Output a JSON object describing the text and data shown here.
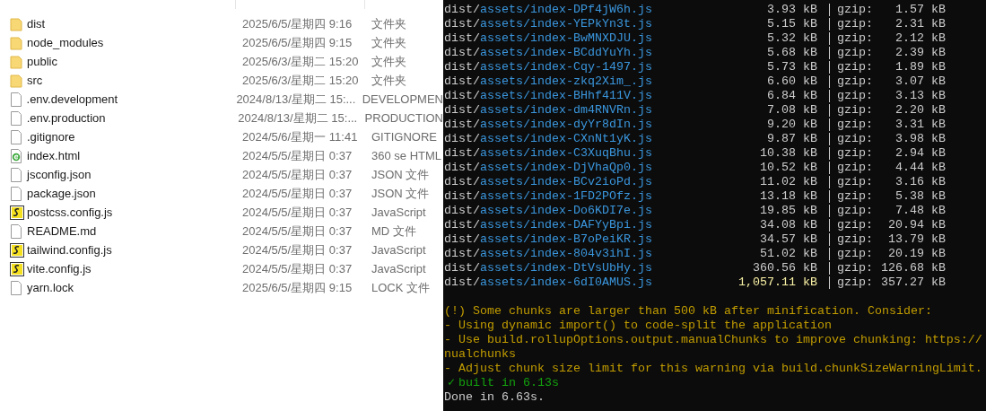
{
  "files": [
    {
      "name": "dist",
      "modified": "2025/6/5/星期四 9:16",
      "type": "文件夹",
      "kind": "folder"
    },
    {
      "name": "node_modules",
      "modified": "2025/6/5/星期四 9:15",
      "type": "文件夹",
      "kind": "folder"
    },
    {
      "name": "public",
      "modified": "2025/6/3/星期二 15:20",
      "type": "文件夹",
      "kind": "folder"
    },
    {
      "name": "src",
      "modified": "2025/6/3/星期二 15:20",
      "type": "文件夹",
      "kind": "folder"
    },
    {
      "name": ".env.development",
      "modified": "2024/8/13/星期二 15:...",
      "type": "DEVELOPMEN",
      "kind": "file"
    },
    {
      "name": ".env.production",
      "modified": "2024/8/13/星期二 15:...",
      "type": "PRODUCTION",
      "kind": "file"
    },
    {
      "name": ".gitignore",
      "modified": "2024/5/6/星期一 11:41",
      "type": "GITIGNORE",
      "kind": "file"
    },
    {
      "name": "index.html",
      "modified": "2024/5/5/星期日 0:37",
      "type": "360 se HTML",
      "kind": "html"
    },
    {
      "name": "jsconfig.json",
      "modified": "2024/5/5/星期日 0:37",
      "type": "JSON 文件",
      "kind": "file"
    },
    {
      "name": "package.json",
      "modified": "2024/5/5/星期日 0:37",
      "type": "JSON 文件",
      "kind": "file"
    },
    {
      "name": "postcss.config.js",
      "modified": "2024/5/5/星期日 0:37",
      "type": "JavaScript",
      "kind": "script"
    },
    {
      "name": "README.md",
      "modified": "2024/5/5/星期日 0:37",
      "type": "MD 文件",
      "kind": "file"
    },
    {
      "name": "tailwind.config.js",
      "modified": "2024/5/5/星期日 0:37",
      "type": "JavaScript",
      "kind": "script"
    },
    {
      "name": "vite.config.js",
      "modified": "2024/5/5/星期日 0:37",
      "type": "JavaScript",
      "kind": "script"
    },
    {
      "name": "yarn.lock",
      "modified": "2025/6/5/星期四 9:15",
      "type": "LOCK 文件",
      "kind": "file"
    }
  ],
  "terminal": {
    "build_rows": [
      {
        "dir": "dist/",
        "path": "assets/index-DPf4jW6h.js",
        "size": "3.93 kB",
        "gzip_label": "gzip:",
        "gzip_size": "1.57 kB",
        "warning": false
      },
      {
        "dir": "dist/",
        "path": "assets/index-YEPkYn3t.js",
        "size": "5.15 kB",
        "gzip_label": "gzip:",
        "gzip_size": "2.31 kB",
        "warning": false
      },
      {
        "dir": "dist/",
        "path": "assets/index-BwMNXDJU.js",
        "size": "5.32 kB",
        "gzip_label": "gzip:",
        "gzip_size": "2.12 kB",
        "warning": false
      },
      {
        "dir": "dist/",
        "path": "assets/index-BCddYuYh.js",
        "size": "5.68 kB",
        "gzip_label": "gzip:",
        "gzip_size": "2.39 kB",
        "warning": false
      },
      {
        "dir": "dist/",
        "path": "assets/index-Cqy-1497.js",
        "size": "5.73 kB",
        "gzip_label": "gzip:",
        "gzip_size": "1.89 kB",
        "warning": false
      },
      {
        "dir": "dist/",
        "path": "assets/index-zkq2Xim_.js",
        "size": "6.60 kB",
        "gzip_label": "gzip:",
        "gzip_size": "3.07 kB",
        "warning": false
      },
      {
        "dir": "dist/",
        "path": "assets/index-BHhf411V.js",
        "size": "6.84 kB",
        "gzip_label": "gzip:",
        "gzip_size": "3.13 kB",
        "warning": false
      },
      {
        "dir": "dist/",
        "path": "assets/index-dm4RNVRn.js",
        "size": "7.08 kB",
        "gzip_label": "gzip:",
        "gzip_size": "2.20 kB",
        "warning": false
      },
      {
        "dir": "dist/",
        "path": "assets/index-dyYr8dIn.js",
        "size": "9.20 kB",
        "gzip_label": "gzip:",
        "gzip_size": "3.31 kB",
        "warning": false
      },
      {
        "dir": "dist/",
        "path": "assets/index-CXnNt1yK.js",
        "size": "9.87 kB",
        "gzip_label": "gzip:",
        "gzip_size": "3.98 kB",
        "warning": false
      },
      {
        "dir": "dist/",
        "path": "assets/index-C3XuqBhu.js",
        "size": "10.38 kB",
        "gzip_label": "gzip:",
        "gzip_size": "2.94 kB",
        "warning": false
      },
      {
        "dir": "dist/",
        "path": "assets/index-DjVhaQp0.js",
        "size": "10.52 kB",
        "gzip_label": "gzip:",
        "gzip_size": "4.44 kB",
        "warning": false
      },
      {
        "dir": "dist/",
        "path": "assets/index-BCv2ioPd.js",
        "size": "11.02 kB",
        "gzip_label": "gzip:",
        "gzip_size": "3.16 kB",
        "warning": false
      },
      {
        "dir": "dist/",
        "path": "assets/index-1FD2POfz.js",
        "size": "13.18 kB",
        "gzip_label": "gzip:",
        "gzip_size": "5.38 kB",
        "warning": false
      },
      {
        "dir": "dist/",
        "path": "assets/index-Do6KDI7e.js",
        "size": "19.85 kB",
        "gzip_label": "gzip:",
        "gzip_size": "7.48 kB",
        "warning": false
      },
      {
        "dir": "dist/",
        "path": "assets/index-DAFYyBpi.js",
        "size": "34.08 kB",
        "gzip_label": "gzip:",
        "gzip_size": "20.94 kB",
        "warning": false
      },
      {
        "dir": "dist/",
        "path": "assets/index-B7oPeiKR.js",
        "size": "34.57 kB",
        "gzip_label": "gzip:",
        "gzip_size": "13.79 kB",
        "warning": false
      },
      {
        "dir": "dist/",
        "path": "assets/index-804v3ihI.js",
        "size": "51.02 kB",
        "gzip_label": "gzip:",
        "gzip_size": "20.19 kB",
        "warning": false
      },
      {
        "dir": "dist/",
        "path": "assets/index-DtVsUbHy.js",
        "size": "360.56 kB",
        "gzip_label": "gzip:",
        "gzip_size": "126.68 kB",
        "warning": false
      },
      {
        "dir": "dist/",
        "path": "assets/index-6dI0AMUS.js",
        "size": "1,057.11 kB",
        "gzip_label": "gzip:",
        "gzip_size": "357.27 kB",
        "warning": true
      }
    ],
    "warnings": [
      "(!) Some chunks are larger than 500 kB after minification. Consider:",
      "- Using dynamic import() to code-split the application",
      "- Use build.rollupOptions.output.manualChunks to improve chunking: https://",
      "nualchunks",
      "- Adjust chunk size limit for this warning via build.chunkSizeWarningLimit."
    ],
    "success": {
      "mark": "✓",
      "text": "built in 6.13s"
    },
    "done": "Done in 6.63s."
  }
}
